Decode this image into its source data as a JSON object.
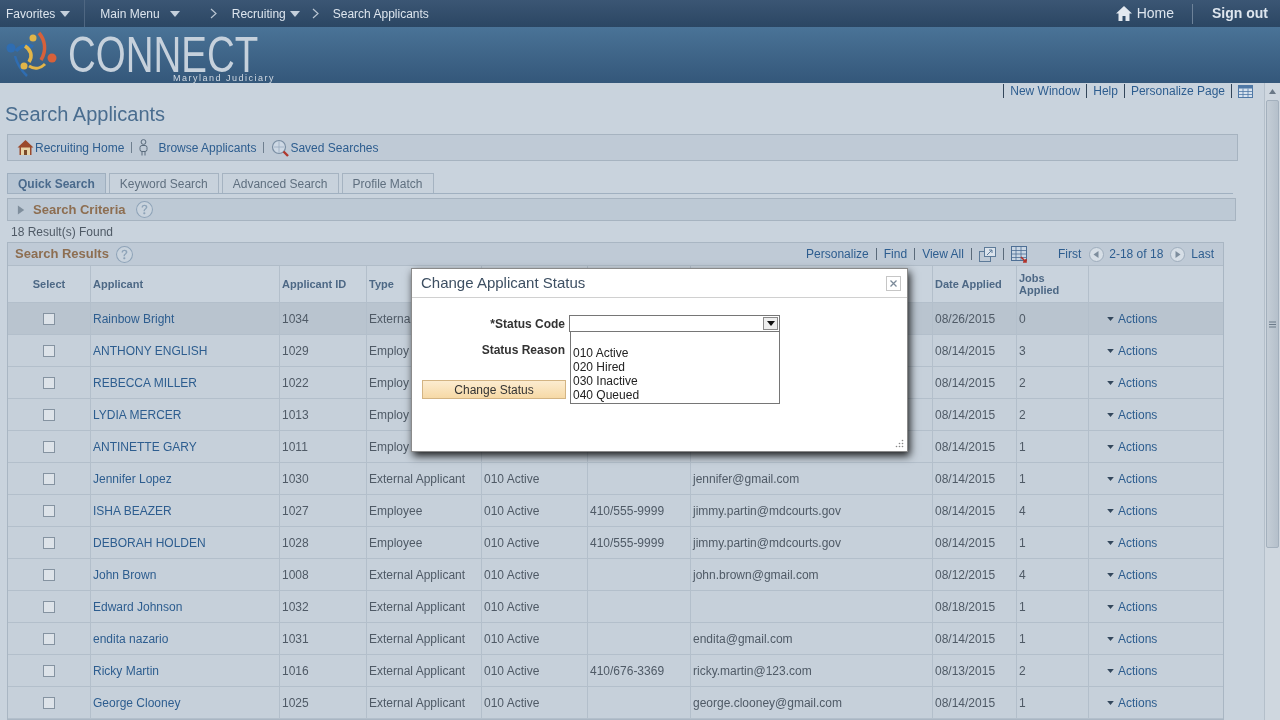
{
  "top_nav": {
    "menus": [
      {
        "label": "Favorites",
        "dropdown": true
      },
      {
        "label": "Main Menu",
        "dropdown": true
      }
    ],
    "breadcrumbs": [
      {
        "label": "Recruiting",
        "dropdown": true
      },
      {
        "label": "Search Applicants",
        "dropdown": false
      }
    ],
    "home": "Home",
    "sign_out": "Sign out"
  },
  "banner": {
    "logo_text": "CONNECT",
    "logo_subtitle": "Maryland Judiciary"
  },
  "page_links": [
    "New Window",
    "Help",
    "Personalize Page"
  ],
  "page_title": "Search Applicants",
  "quick_links": [
    {
      "label": "Recruiting Home",
      "kind": "home"
    },
    {
      "label": "Browse Applicants",
      "kind": "person"
    },
    {
      "label": "Saved Searches",
      "kind": "search"
    }
  ],
  "tabs": [
    {
      "label": "Quick Search",
      "selected": true
    },
    {
      "label": "Keyword Search",
      "selected": false
    },
    {
      "label": "Advanced Search",
      "selected": false
    },
    {
      "label": "Profile Match",
      "selected": false
    }
  ],
  "search_criteria": {
    "label": "Search Criteria",
    "expanded": false
  },
  "result_count": "18 Result(s) Found",
  "results_grid": {
    "title": "Search Results",
    "tools": [
      "Personalize",
      "Find",
      "View All"
    ],
    "first": "First",
    "range": "2-18 of 18",
    "last": "Last",
    "headings": {
      "select": "Select",
      "applicant": "Applicant",
      "applicant_id": "Applicant ID",
      "type": "Type",
      "date_applied": "Date Applied",
      "jobs_applied": "Jobs Applied"
    },
    "rows": [
      {
        "checked": false,
        "selected": true,
        "applicant": "Rainbow Bright",
        "applicant_id": "1034",
        "type": "Externa",
        "date_applied": "08/26/2015",
        "jobs_applied": "0",
        "action": "Actions"
      },
      {
        "checked": false,
        "selected": false,
        "applicant": "ANTHONY ENGLISH",
        "applicant_id": "1029",
        "type": "Employ",
        "date_applied": "08/14/2015",
        "jobs_applied": "3",
        "action": "Actions"
      },
      {
        "checked": false,
        "selected": false,
        "applicant": "REBECCA MILLER",
        "applicant_id": "1022",
        "type": "Employ",
        "date_applied": "08/14/2015",
        "jobs_applied": "2",
        "action": "Actions"
      },
      {
        "checked": false,
        "selected": false,
        "applicant": "LYDIA MERCER",
        "applicant_id": "1013",
        "type": "Employ",
        "date_applied": "08/14/2015",
        "jobs_applied": "2",
        "action": "Actions"
      },
      {
        "checked": false,
        "selected": false,
        "applicant": "ANTINETTE GARY",
        "applicant_id": "1011",
        "type": "Employ",
        "date_applied": "08/14/2015",
        "jobs_applied": "1",
        "action": "Actions"
      },
      {
        "checked": false,
        "selected": false,
        "applicant": "Jennifer Lopez",
        "applicant_id": "1030",
        "type": "External Applicant",
        "column_5": "010 Active",
        "column_7": "jennifer@gmail.com",
        "date_applied": "08/14/2015",
        "jobs_applied": "1",
        "action": "Actions"
      },
      {
        "checked": false,
        "selected": false,
        "applicant": "ISHA BEAZER",
        "applicant_id": "1027",
        "type": "Employee",
        "column_5": "010 Active",
        "column_6": "410/555-9999",
        "column_7": "jimmy.partin@mdcourts.gov",
        "date_applied": "08/14/2015",
        "jobs_applied": "4",
        "action": "Actions"
      },
      {
        "checked": false,
        "selected": false,
        "applicant": "DEBORAH HOLDEN",
        "applicant_id": "1028",
        "type": "Employee",
        "column_5": "010 Active",
        "column_6": "410/555-9999",
        "column_7": "jimmy.partin@mdcourts.gov",
        "date_applied": "08/14/2015",
        "jobs_applied": "1",
        "action": "Actions"
      },
      {
        "checked": false,
        "selected": false,
        "applicant": "John Brown",
        "applicant_id": "1008",
        "type": "External Applicant",
        "column_5": "010 Active",
        "column_7": "john.brown@gmail.com",
        "date_applied": "08/12/2015",
        "jobs_applied": "4",
        "action": "Actions"
      },
      {
        "checked": false,
        "selected": false,
        "applicant": "Edward Johnson",
        "applicant_id": "1032",
        "type": "External Applicant",
        "column_5": "010 Active",
        "date_applied": "08/18/2015",
        "jobs_applied": "1",
        "action": "Actions"
      },
      {
        "checked": false,
        "selected": false,
        "applicant": "endita nazario",
        "applicant_id": "1031",
        "type": "External Applicant",
        "column_5": "010 Active",
        "column_7": "endita@gmail.com",
        "date_applied": "08/14/2015",
        "jobs_applied": "1",
        "action": "Actions"
      },
      {
        "checked": false,
        "selected": false,
        "applicant": "Ricky Martin",
        "applicant_id": "1016",
        "type": "External Applicant",
        "column_5": "010 Active",
        "column_6": "410/676-3369",
        "column_7": "ricky.martin@123.com",
        "date_applied": "08/13/2015",
        "jobs_applied": "2",
        "action": "Actions"
      },
      {
        "checked": false,
        "selected": false,
        "applicant": "George Clooney",
        "applicant_id": "1025",
        "type": "External Applicant",
        "column_5": "010 Active",
        "column_7": "george.clooney@gmail.com",
        "date_applied": "08/14/2015",
        "jobs_applied": "1",
        "action": "Actions"
      }
    ]
  },
  "dialog": {
    "title": "Change Applicant Status",
    "status_code": {
      "label": "*Status Code",
      "expanded": true,
      "options": [
        {
          "label": "010 Active",
          "selected": false
        },
        {
          "label": "020 Hired",
          "selected": false
        },
        {
          "label": "030 Inactive",
          "selected": false
        },
        {
          "label": "040 Queued",
          "selected": false
        }
      ]
    },
    "status_reason": {
      "label": "Status Reason"
    },
    "button": "Change Status"
  }
}
